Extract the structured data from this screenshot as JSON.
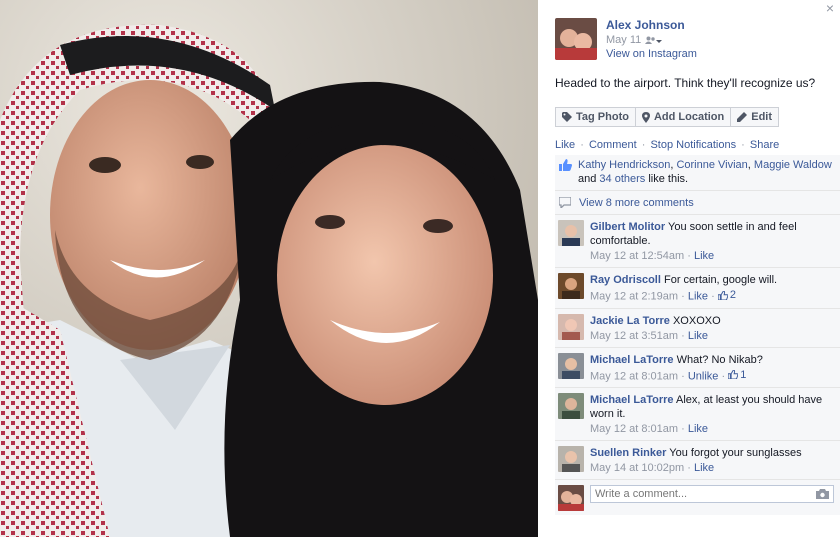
{
  "window": {
    "close_glyph": "×"
  },
  "post": {
    "author": "Alex Johnson",
    "date": "May 11",
    "audience_icon": "friends-icon",
    "view_link": "View on Instagram",
    "caption": "Headed to the airport. Think they'll recognize us?"
  },
  "actions": {
    "tag_photo": "Tag Photo",
    "add_location": "Add Location",
    "edit": "Edit"
  },
  "links": {
    "like": "Like",
    "comment": "Comment",
    "stop_notifications": "Stop Notifications",
    "share": "Share",
    "separator": "·"
  },
  "likes": {
    "name1": "Kathy Hendrickson",
    "name2": "Corinne Vivian",
    "name3": "Maggie Waldow",
    "and_text": "and",
    "others": "34 others",
    "tail": "like this."
  },
  "more_comments": "View 8 more comments",
  "comments": [
    {
      "name": "Gilbert Molitor",
      "text": "You soon settle in and feel comfortable.",
      "time": "May 12 at 12:54am",
      "action": "Like",
      "likes": ""
    },
    {
      "name": "Ray Odriscoll",
      "text": "For certain, google will.",
      "time": "May 12 at 2:19am",
      "action": "Like",
      "likes": "2"
    },
    {
      "name": "Jackie La Torre",
      "text": "XOXOXO",
      "time": "May 12 at 3:51am",
      "action": "Like",
      "likes": ""
    },
    {
      "name": "Michael LaTorre",
      "text": "What? No Nikab?",
      "time": "May 12 at 8:01am",
      "action": "Unlike",
      "likes": "1"
    },
    {
      "name": "Michael LaTorre",
      "text": "Alex, at least you should have worn it.",
      "time": "May 12 at 8:01am",
      "action": "Like",
      "likes": ""
    },
    {
      "name": "Suellen Rinker",
      "text": "You forgot your sunglasses",
      "time": "May 14 at 10:02pm",
      "action": "Like",
      "likes": ""
    }
  ],
  "composer": {
    "placeholder": "Write a comment..."
  },
  "colors": {
    "link": "#3b5998",
    "meta": "#9197a3",
    "feed_bg": "#f6f7f9"
  }
}
